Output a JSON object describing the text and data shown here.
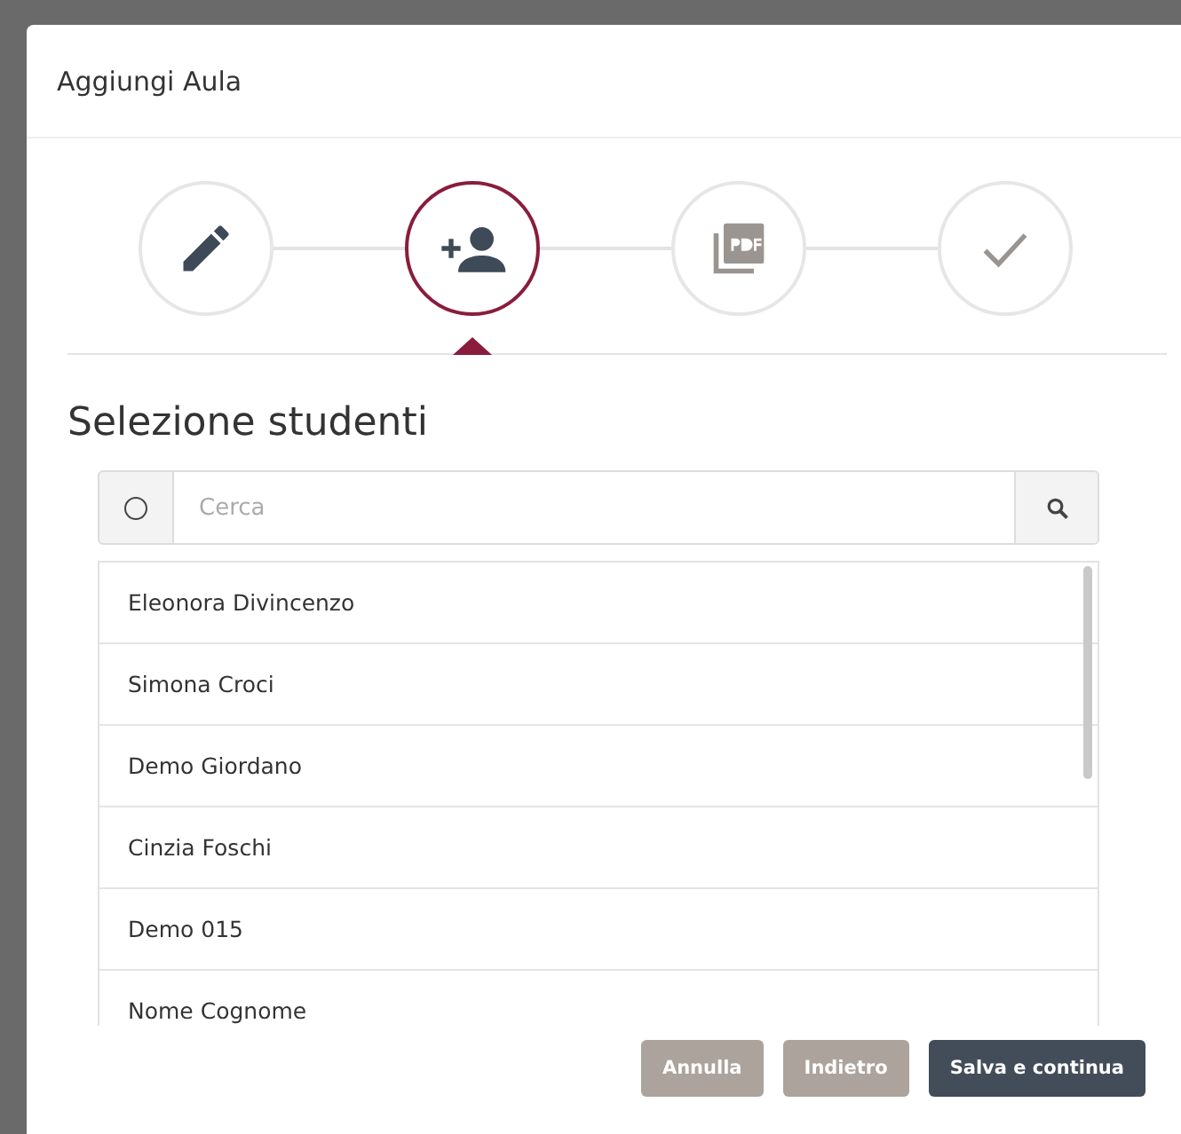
{
  "dialog": {
    "title": "Aggiungi Aula"
  },
  "steps": [
    {
      "kind": "edit",
      "selected": false,
      "completed": true
    },
    {
      "kind": "add-user",
      "selected": true,
      "completed": false
    },
    {
      "kind": "pdf",
      "selected": false,
      "completed": false
    },
    {
      "kind": "done",
      "selected": false,
      "completed": false
    }
  ],
  "section_title": "Selezione studenti",
  "search": {
    "placeholder": "Cerca",
    "select_all_checked": false
  },
  "students": [
    {
      "name": "Eleonora Divincenzo"
    },
    {
      "name": "Simona Croci"
    },
    {
      "name": "Demo Giordano"
    },
    {
      "name": "Cinzia Foschi"
    },
    {
      "name": "Demo 015"
    },
    {
      "name": "Nome Cognome"
    }
  ],
  "buttons": [
    {
      "label": "Annulla",
      "kind": "secondary"
    },
    {
      "label": "Indietro",
      "kind": "secondary"
    },
    {
      "label": "Salva e continua",
      "kind": "primary"
    }
  ]
}
